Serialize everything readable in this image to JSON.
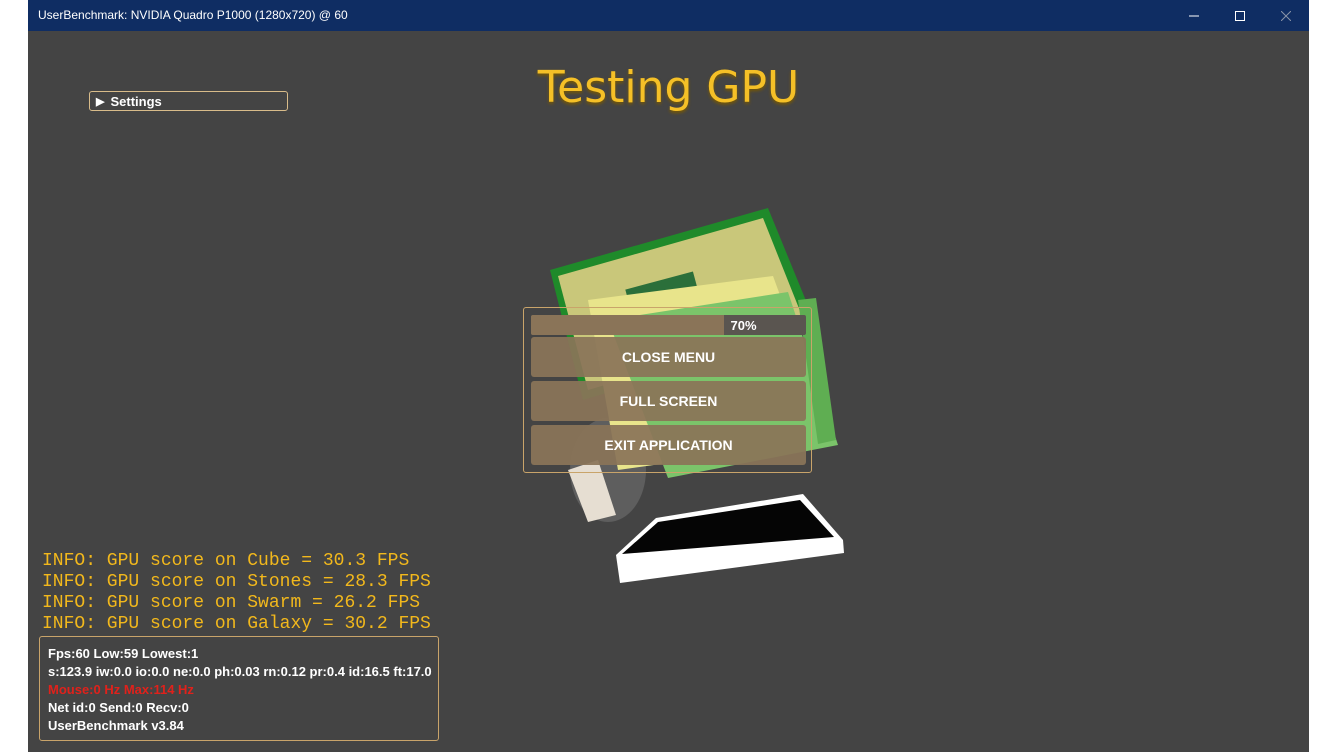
{
  "window": {
    "title": "UserBenchmark: NVIDIA Quadro P1000 (1280x720) @ 60",
    "minimize_icon": "minimize-icon",
    "maximize_icon": "maximize-icon",
    "close_icon": "close-icon"
  },
  "heading": "Testing GPU",
  "settings": {
    "label": "Settings",
    "icon": "triangle-right-icon"
  },
  "menu": {
    "progress_value": 0.7,
    "progress_label": "70%",
    "buttons": [
      "CLOSE MENU",
      "FULL SCREEN",
      "EXIT APPLICATION"
    ]
  },
  "info_lines": [
    "INFO: GPU score on Cube = 30.3 FPS",
    "INFO: GPU score on Stones = 28.3 FPS",
    "INFO: GPU score on Swarm = 26.2 FPS",
    "INFO: GPU score on Galaxy = 30.2 FPS"
  ],
  "stats": {
    "fps": "Fps:60 Low:59 Lowest:1",
    "timings": "s:123.9 iw:0.0 io:0.0 ne:0.0 ph:0.03 rn:0.12 pr:0.4 id:16.5 ft:17.0",
    "mouse": "Mouse:0 Hz Max:114 Hz",
    "net": "Net id:0 Send:0 Recv:0",
    "version": "UserBenchmark v3.84"
  },
  "colors": {
    "title_bar": "#0f2d63",
    "background": "#444444",
    "heading": "#f5c027",
    "info_text": "#f2b81c",
    "menu_button": "#8a7458",
    "border_accent": "#c9a46a",
    "warning_text": "#e0211b"
  }
}
